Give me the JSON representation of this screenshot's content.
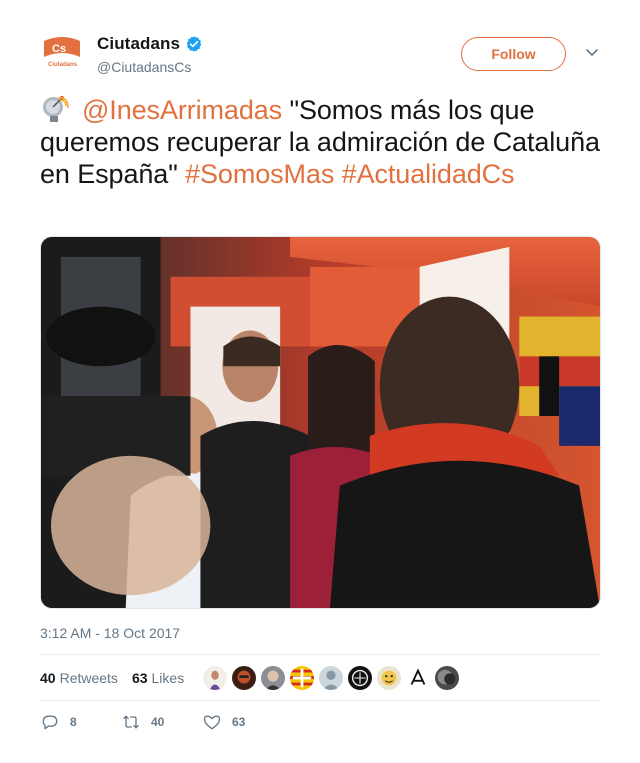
{
  "account": {
    "display_name": "Ciutadans",
    "handle": "@CiutadansCs",
    "avatar_text": "Ciutadans",
    "avatar_logo": "Cs",
    "verified": true
  },
  "follow_button": {
    "label": "Follow"
  },
  "tweet": {
    "emoji": "satellite-antenna-emoji",
    "mention": "@InesArrimadas",
    "text_part1": " \"Somos más los que queremos recuperar la admiración de Cataluña en España\" ",
    "hashtag1": "#SomosMas",
    "hashtag2": "#ActualidadCs"
  },
  "timestamp": "3:12 AM - 18 Oct 2017",
  "stats": {
    "retweets_count": "40",
    "retweets_label": "Retweets",
    "likes_count": "63",
    "likes_label": "Likes"
  },
  "actions": {
    "reply_count": "8",
    "retweet_count": "40",
    "like_count": "63"
  },
  "colors": {
    "accent": "#e2713f",
    "text": "#14171a",
    "muted": "#657786",
    "verified": "#1da1f2"
  },
  "icons": [
    "chevron-down-icon",
    "verified-icon",
    "reply-icon",
    "retweet-icon",
    "heart-icon"
  ]
}
